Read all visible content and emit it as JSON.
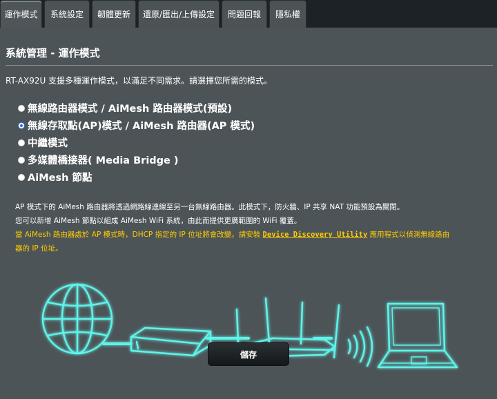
{
  "tabs": [
    {
      "label": "運作模式",
      "active": true
    },
    {
      "label": "系統設定",
      "active": false
    },
    {
      "label": "韌體更新",
      "active": false
    },
    {
      "label": "還原/匯出/上傳設定",
      "active": false
    },
    {
      "label": "問題回報",
      "active": false
    },
    {
      "label": "隱私權",
      "active": false
    }
  ],
  "page": {
    "title": "系統管理 - 運作模式",
    "description": "RT-AX92U 支援多種運作模式，以滿足不同需求。請選擇您所需的模式。"
  },
  "modes": [
    {
      "label": "無線路由器模式 / AiMesh 路由器模式(預設)",
      "selected": false
    },
    {
      "label": "無線存取點(AP)模式 / AiMesh 路由器(AP 模式)",
      "selected": true
    },
    {
      "label": "中繼模式",
      "selected": false
    },
    {
      "label": "多媒體橋接器( Media Bridge )",
      "selected": false
    },
    {
      "label": "AiMesh 節點",
      "selected": false
    }
  ],
  "info": {
    "line1": "AP 模式下的 AiMesh 路由器將透過網路線連線至另一台無線路由器。此模式下，防火牆、IP 共享 NAT 功能預設為關閉。",
    "line2": "您可以新增 AiMesh 節點以組成 AiMesh WiFi 系統，由此而提供更廣範圍的 WiFi 覆蓋。",
    "line3_pre": "當 AiMesh 路由器處於 AP 模式時，DHCP 指定的 IP 位址將會改變。請安裝 ",
    "link": "Device Discovery Utility",
    "line3_post": " 應用程式以偵測無線路由",
    "line4": "器的 IP 位址。"
  },
  "buttons": {
    "save": "儲存"
  },
  "colors": {
    "accent": "#5ff3ea",
    "warning": "#ffcc00",
    "panel": "#4d5457"
  }
}
